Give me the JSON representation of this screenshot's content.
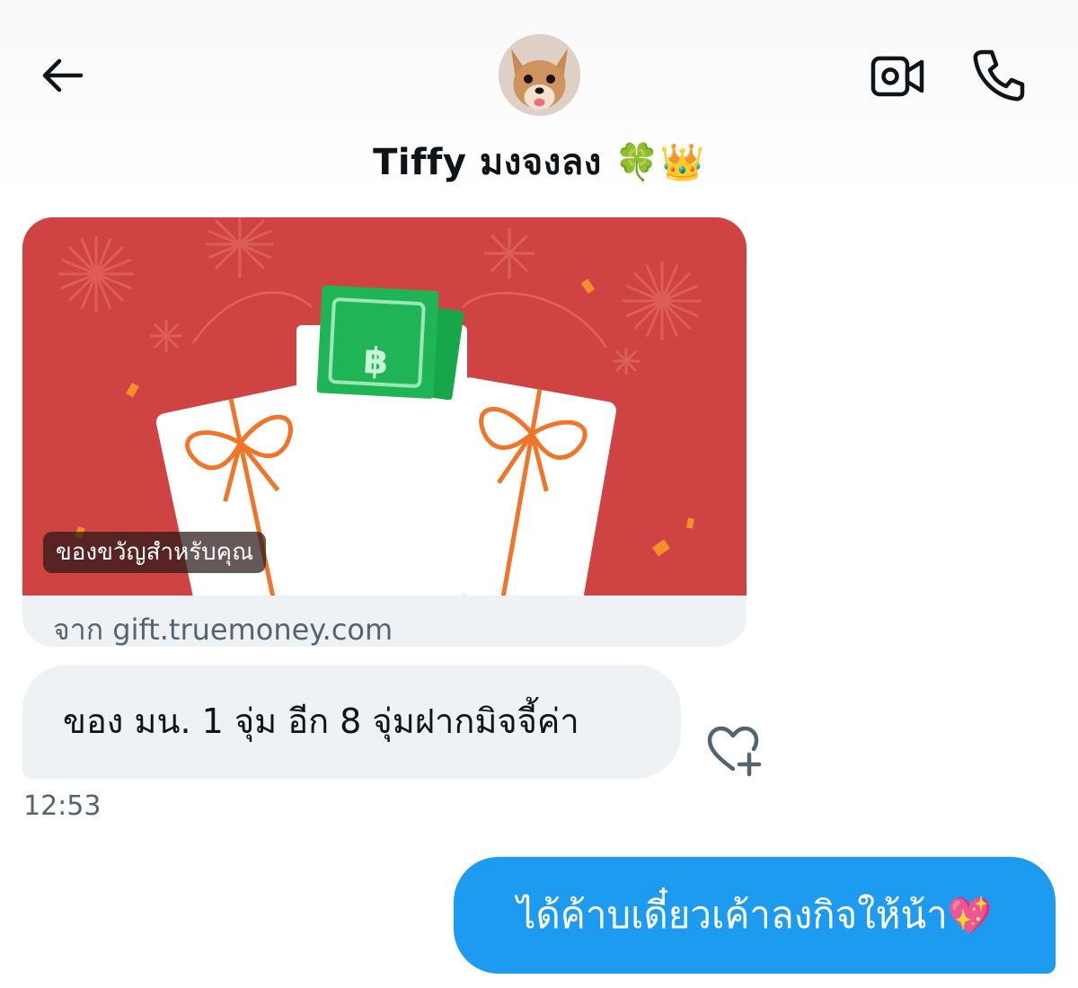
{
  "header": {
    "back_icon": "arrow-left-icon",
    "contact_name": "Tiffy มงจงลง",
    "name_emojis": "🍀👑",
    "avatar": "chihuahua-dog-photo",
    "video_icon": "video-camera-icon",
    "call_icon": "phone-icon"
  },
  "messages": {
    "card": {
      "image_label": "ของขวัญสำหรับคุณ",
      "footer": "จาก gift.truemoney.com",
      "image": "gift-envelope-with-banknotes",
      "background_color": "#cf4443"
    },
    "incoming_text": "ของ มน. 1 จุ่ม อีก 8 จุ่มฝากมิจจี้ค่า",
    "reaction_icon": "heart-plus-icon",
    "timestamp": "12:53",
    "outgoing_text": "ได้ค้าบเดี๋ยวเค้าลงกิจให้น้า",
    "outgoing_emoji": "💖"
  },
  "colors": {
    "accent": "#1d9bf0",
    "incoming_bubble": "#eff2f4",
    "secondary_text": "#536471"
  }
}
